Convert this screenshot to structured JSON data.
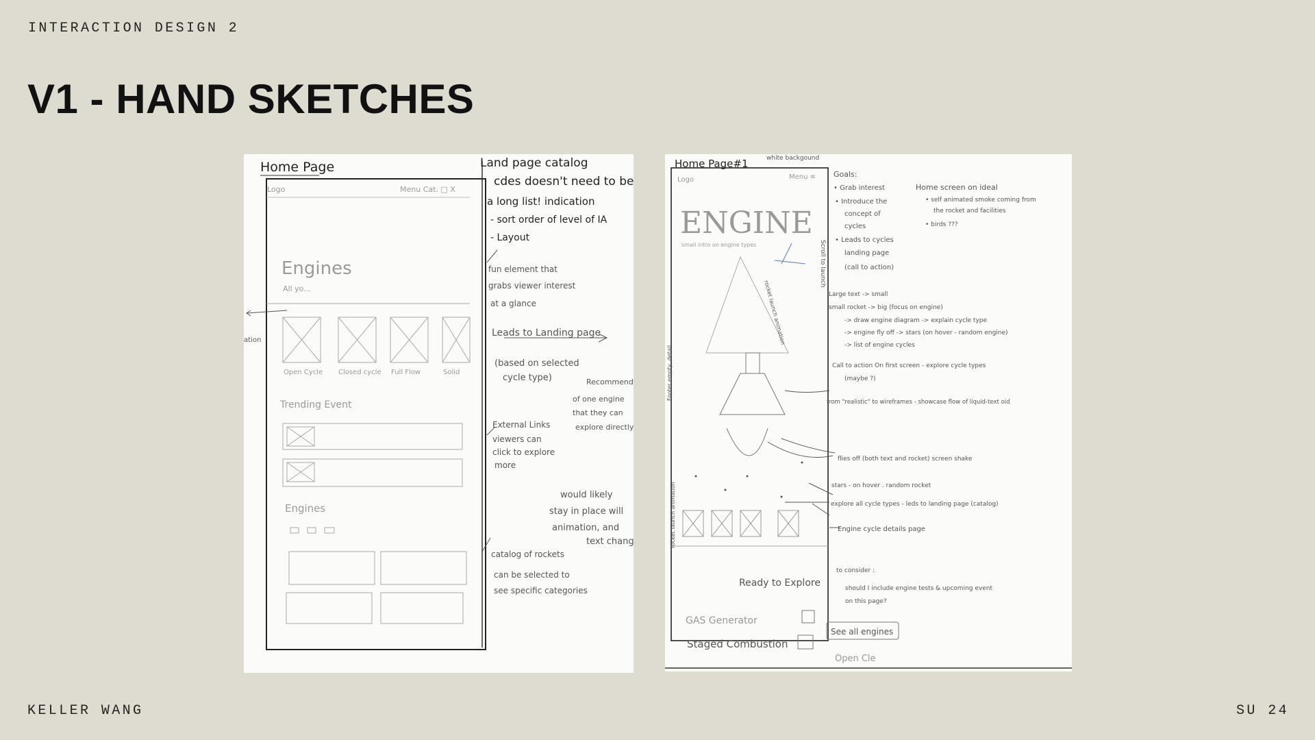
{
  "header": {
    "course": "INTERACTION DESIGN 2",
    "title": "V1 - HAND SKETCHES"
  },
  "footer": {
    "author": "KELLER WANG",
    "term": "SU 24"
  },
  "sketch1": {
    "page_title": "Home Page",
    "nav_logo": "Logo",
    "nav_menu": "Menu Cat. □ X",
    "hero_title": "Engines",
    "hero_sub": "All yo...",
    "thumb_labels": [
      "Open Cycle",
      "Closed cycle",
      "Full Flow",
      "Solid"
    ],
    "trending": "Trending Event",
    "engines": "Engines",
    "notes": {
      "n1_a": "Land page  catalog",
      "n1_b": "cdes doesn't need to be",
      "n1_c": "a long list! indication",
      "n1_d": "- sort order of level of IA",
      "n1_e": "- Layout",
      "n2_a": "fun element that",
      "n2_b": "grabs viewer interest",
      "n2_c": "at a glance",
      "n3_a": "Leads to Landing page",
      "n3_b": "(based on selected",
      "n3_c": "cycle type)",
      "n4_a": "Recommendatio",
      "n4_b": "of one engine",
      "n4_c": "that they can",
      "n4_d": "explore directly",
      "n5_a": "External Links",
      "n5_b": "viewers can",
      "n5_c": "click to explore",
      "n5_d": "more",
      "n6_a": "would likely",
      "n6_b": "stay in place will",
      "n6_c": "animation, and",
      "n6_d": "text chang",
      "n7_a": "catalog of rockets",
      "n7_b": "can be selected to",
      "n7_c": "see specific categories",
      "side": "ation"
    }
  },
  "sketch2": {
    "page_title": "Home Page#1",
    "bg_note": "white backgound",
    "nav_logo": "Logo",
    "nav_menu": "Menu ≡",
    "hero_title": "ENGINE",
    "hero_sub": "small intro on engine types",
    "ready": "Ready to Explore",
    "gas": "GAS Generator",
    "staged": "Staged Combustion",
    "open": "Open Cle",
    "see_all": "See all engines",
    "vert_left": "Footer empty, detail",
    "vert_left2": "rocket launch animation",
    "vert_mid": "Scroll to launch",
    "vert_mid2": "rocket launch animation",
    "notes": {
      "goals": "Goals:",
      "g1": "• Grab interest",
      "g2": "• Introduce the",
      "g2b": "concept of",
      "g2c": "cycles",
      "g3": "• Leads to cycles",
      "g3b": "landing page",
      "g3c": "(call to action)",
      "h1": "Home screen on ideal",
      "h2": "• self animated smoke coming from",
      "h3": "the rocket and facilities",
      "h4": "• birds ???",
      "l1": "Large text -> small",
      "l2": "small rocket -> big (focus on engine)",
      "l3": "-> draw engine diagram -> explain cycle type",
      "l4": "-> engine fly off -> stars (on hover - random engine)",
      "l5": "-> list of engine cycles",
      "c1": "Call to action On first screen - explore cycle types",
      "c2": "(maybe ?)",
      "r1": "from \"realistic\" to wireframes - showcase flow of liquid-text oid",
      "f1": "flies off (both text and rocket)  screen shake",
      "s1": "stars - on hover . random rocket",
      "e1": "explore all cycle types - leds to landing page (catalog)",
      "d1": "Engine cycle details page",
      "t1": "to consider :",
      "t2": "should I include engine tests & upcoming event",
      "t3": "on this page?"
    }
  }
}
